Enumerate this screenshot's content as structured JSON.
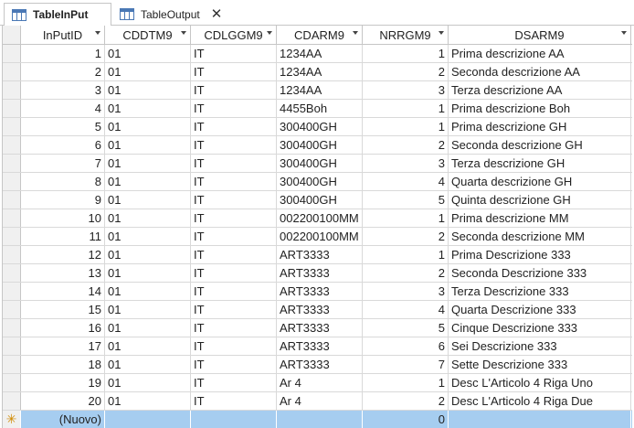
{
  "tabs": [
    {
      "label": "TableInPut",
      "active": true
    },
    {
      "label": "TableOutput",
      "active": false
    }
  ],
  "columns": [
    "InPutID",
    "CDDTM9",
    "CDLGGM9",
    "CDARM9",
    "NRRGM9",
    "DSARM9"
  ],
  "rows": [
    [
      "1",
      "01",
      "IT",
      "1234AA",
      "1",
      "Prima descrizione AA"
    ],
    [
      "2",
      "01",
      "IT",
      "1234AA",
      "2",
      "Seconda descrizione AA"
    ],
    [
      "3",
      "01",
      "IT",
      "1234AA",
      "3",
      "Terza descrizione AA"
    ],
    [
      "4",
      "01",
      "IT",
      "4455Boh",
      "1",
      "Prima descrizione Boh"
    ],
    [
      "5",
      "01",
      "IT",
      "300400GH",
      "1",
      "Prima descrizione GH"
    ],
    [
      "6",
      "01",
      "IT",
      "300400GH",
      "2",
      "Seconda descrizione GH"
    ],
    [
      "7",
      "01",
      "IT",
      "300400GH",
      "3",
      "Terza descrizione GH"
    ],
    [
      "8",
      "01",
      "IT",
      "300400GH",
      "4",
      "Quarta descrizione GH"
    ],
    [
      "9",
      "01",
      "IT",
      "300400GH",
      "5",
      "Quinta descrizione GH"
    ],
    [
      "10",
      "01",
      "IT",
      "002200100MM",
      "1",
      "Prima descrizione MM"
    ],
    [
      "11",
      "01",
      "IT",
      "002200100MM",
      "2",
      "Seconda descrizione MM"
    ],
    [
      "12",
      "01",
      "IT",
      "ART3333",
      "1",
      "Prima Descrizione 333"
    ],
    [
      "13",
      "01",
      "IT",
      "ART3333",
      "2",
      "Seconda Descrizione 333"
    ],
    [
      "14",
      "01",
      "IT",
      "ART3333",
      "3",
      "Terza Descrizione 333"
    ],
    [
      "15",
      "01",
      "IT",
      "ART3333",
      "4",
      "Quarta Descrizione 333"
    ],
    [
      "16",
      "01",
      "IT",
      "ART3333",
      "5",
      "Cinque Descrizione 333"
    ],
    [
      "17",
      "01",
      "IT",
      "ART3333",
      "6",
      "Sei Descrizione 333"
    ],
    [
      "18",
      "01",
      "IT",
      "ART3333",
      "7",
      "Sette Descrizione 333"
    ],
    [
      "19",
      "01",
      "IT",
      "Ar 4",
      "1",
      "Desc L'Articolo 4 Riga Uno"
    ],
    [
      "20",
      "01",
      "IT",
      "Ar 4",
      "2",
      "Desc L'Articolo 4 Riga Due"
    ]
  ],
  "new_row": {
    "marker": "✳",
    "id_label": "(Nuovo)",
    "nrrgm9": "0"
  },
  "colors": {
    "new_row": "#a6cdf0",
    "tab_icon": "#4a78b5",
    "new_marker": "#d08a00"
  }
}
